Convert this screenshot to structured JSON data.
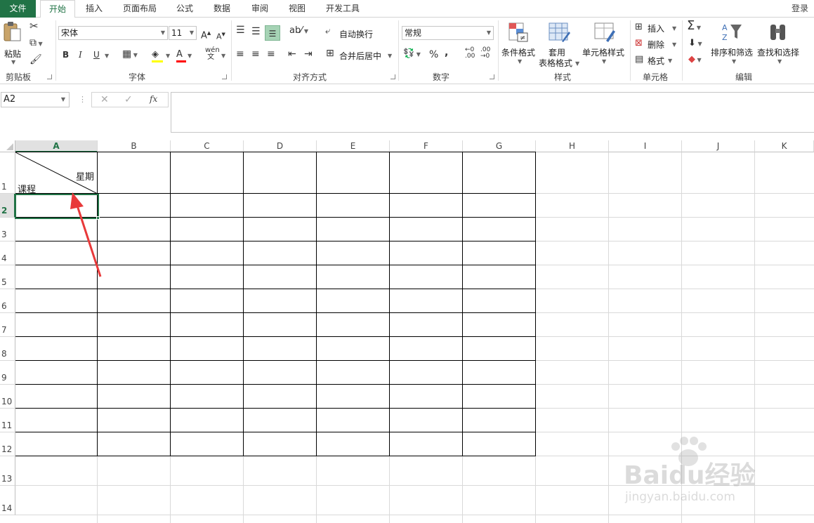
{
  "menu": {
    "file": "文件",
    "tabs": [
      "开始",
      "插入",
      "页面布局",
      "公式",
      "数据",
      "审阅",
      "视图",
      "开发工具"
    ],
    "login": "登录"
  },
  "ribbon": {
    "clipboard": {
      "paste": "粘贴",
      "label": "剪贴板"
    },
    "font": {
      "name": "宋体",
      "size": "11",
      "bold": "B",
      "italic": "I",
      "underline": "U",
      "label": "字体"
    },
    "alignment": {
      "wrap": "自动换行",
      "merge": "合并后居中",
      "label": "对齐方式"
    },
    "number": {
      "format": "常规",
      "percent": "%",
      "comma": "，",
      "label": "数字"
    },
    "styles": {
      "conditional": "条件格式",
      "table1": "套用",
      "table2": "表格格式",
      "cell_styles": "单元格样式",
      "label": "样式"
    },
    "cells": {
      "insert": "插入",
      "delete": "删除",
      "format": "格式",
      "label": "单元格"
    },
    "editing": {
      "sort": "排序和筛选",
      "find": "查找和选择",
      "label": "编辑"
    }
  },
  "formula_bar": {
    "name_box": "A2",
    "fx": "fx"
  },
  "grid": {
    "columns": [
      "A",
      "B",
      "C",
      "D",
      "E",
      "F",
      "G",
      "H",
      "I",
      "J",
      "K"
    ],
    "rows": [
      "1",
      "2",
      "3",
      "4",
      "5",
      "6",
      "7",
      "8",
      "9",
      "10",
      "11",
      "12",
      "13",
      "14"
    ],
    "a1_top_right": "星期",
    "a1_bottom_left": "课程",
    "selected_cell": "A2"
  },
  "watermark": {
    "brand": "Baidu经验",
    "url": "jingyan.baidu.com"
  },
  "colors": {
    "excel_green": "#217346",
    "arrow_red": "#e8393a"
  }
}
